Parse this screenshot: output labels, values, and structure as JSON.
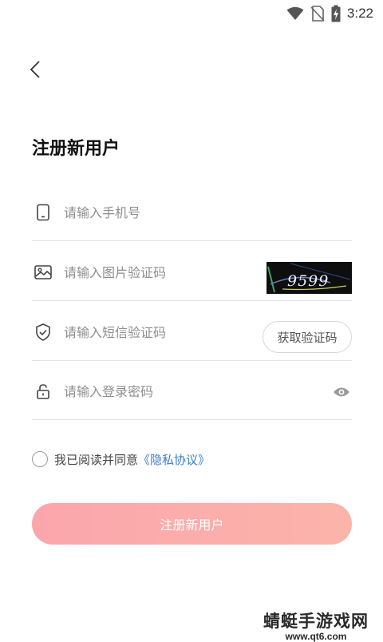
{
  "status_bar": {
    "time": "3:22"
  },
  "header": {
    "title": "注册新用户"
  },
  "form": {
    "phone": {
      "placeholder": "请输入手机号"
    },
    "captcha": {
      "placeholder": "请输入图片验证码",
      "image_text": "9599"
    },
    "sms": {
      "placeholder": "请输入短信验证码",
      "button_label": "获取验证码"
    },
    "password": {
      "placeholder": "请输入登录密码"
    }
  },
  "agreement": {
    "text": "我已阅读并同意",
    "link": "《隐私协议》",
    "checked": false
  },
  "submit": {
    "label": "注册新用户"
  },
  "watermark": {
    "title": "蜻蜓手游戏网",
    "url": "www.qt6.com"
  },
  "colors": {
    "accent_link": "#3b7ecb",
    "button_gradient_start": "#fba6ac",
    "button_gradient_end": "#fbb4aa"
  }
}
